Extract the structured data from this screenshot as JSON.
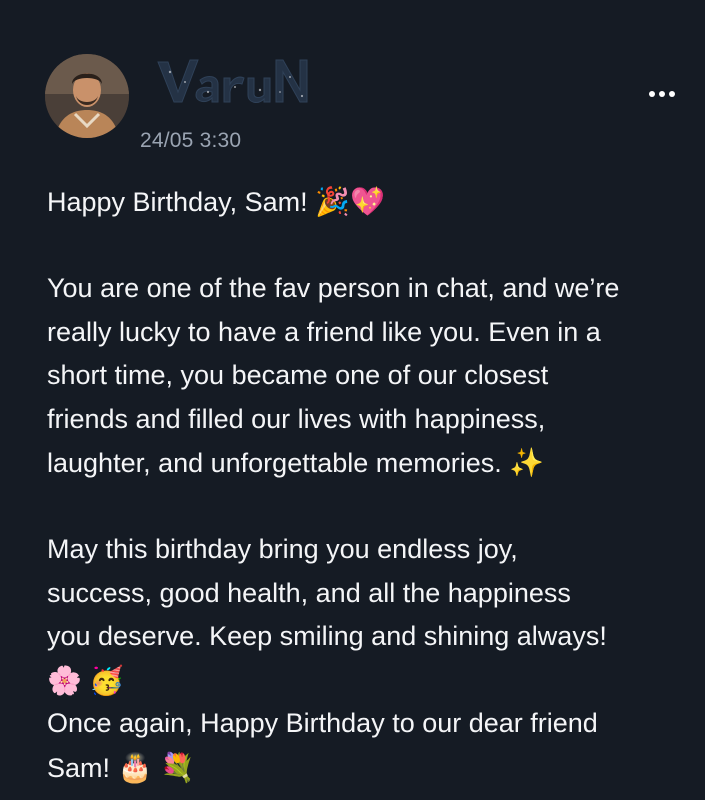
{
  "post": {
    "author": "VaruN",
    "timestamp": "24/05 3:30",
    "menu_icon": "more-horizontal-icon"
  },
  "message": {
    "greeting": "Happy Birthday, Sam!",
    "greeting_emojis": [
      "🎉",
      "💖"
    ],
    "paragraph1_lines": [
      "You are one of the fav person in chat, and we’re",
      "really lucky to have a friend like you. Even in a",
      "short time, you became one of our closest",
      "friends and filled our lives with happiness,",
      "laughter, and unforgettable memories."
    ],
    "paragraph1_emoji": "✨",
    "paragraph2_lines": [
      "May this birthday bring you endless joy,",
      "success, good health, and all the happiness",
      "you deserve. Keep smiling and shining always!"
    ],
    "paragraph2_emojis": [
      "🌸",
      "🥳"
    ],
    "closing_lines": [
      "Once again, Happy Birthday to our dear friend",
      "Sam!"
    ],
    "closing_emojis": [
      "🎂",
      "💐"
    ]
  },
  "colors": {
    "background": "#151b24",
    "text": "#f4f5f7",
    "timestamp": "#9aa4b2"
  }
}
